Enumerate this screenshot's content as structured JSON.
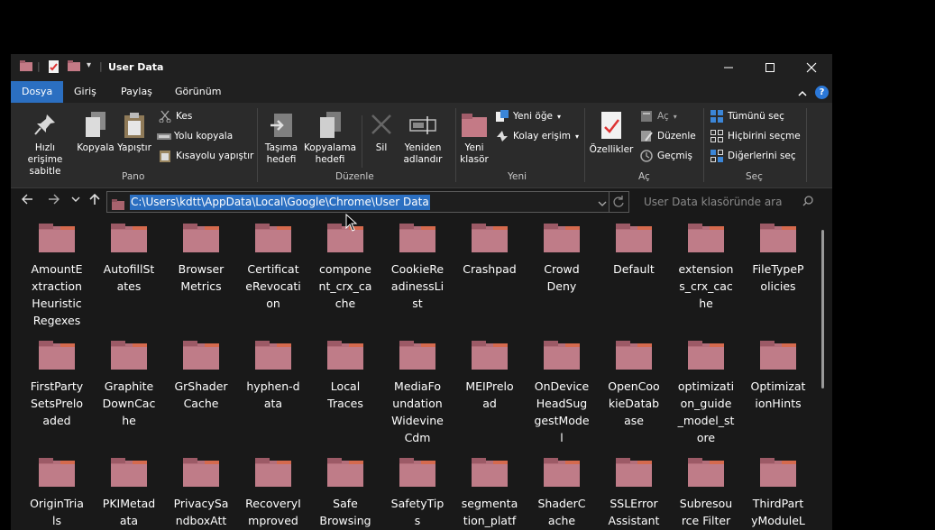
{
  "window": {
    "title": "User Data"
  },
  "tabs": [
    "Dosya",
    "Giriş",
    "Paylaş",
    "Görünüm"
  ],
  "ribbon": {
    "pano": {
      "label": "Pano",
      "pin": "Hızlı erişime sabitle",
      "copy": "Kopyala",
      "paste": "Yapıştır",
      "cut": "Kes",
      "copy_path": "Yolu kopyala",
      "paste_shortcut": "Kısayolu yapıştır"
    },
    "duzenle": {
      "label": "Düzenle",
      "move_to": "Taşıma hedefi",
      "copy_to": "Kopyalama hedefi",
      "delete": "Sil",
      "rename": "Yeniden adlandır"
    },
    "yeni": {
      "label": "Yeni",
      "new_folder": "Yeni klasör",
      "new_item": "Yeni öğe",
      "easy_access": "Kolay erişim"
    },
    "ac": {
      "label": "Aç",
      "properties": "Özellikler",
      "open": "Aç",
      "edit": "Düzenle",
      "history": "Geçmiş"
    },
    "sec": {
      "label": "Seç",
      "select_all": "Tümünü seç",
      "select_none": "Hiçbirini seçme",
      "invert": "Diğerlerini seç"
    }
  },
  "address": {
    "path": "C:\\Users\\kdtt\\AppData\\Local\\Google\\Chrome\\User Data",
    "search_placeholder": "User Data klasöründe ara"
  },
  "folders": [
    [
      "AmountE",
      "xtraction",
      "Heuristic",
      "Regexes"
    ],
    [
      "AutofillSt",
      "ates"
    ],
    [
      "Browser",
      "Metrics"
    ],
    [
      "Certificat",
      "eRevocati",
      "on"
    ],
    [
      "compone",
      "nt_crx_ca",
      "che"
    ],
    [
      "CookieRe",
      "adinessLi",
      "st"
    ],
    [
      "Crashpad"
    ],
    [
      "Crowd",
      "Deny"
    ],
    [
      "Default"
    ],
    [
      "extension",
      "s_crx_cac",
      "he"
    ],
    [
      "FileTypeP",
      "olicies"
    ],
    [
      "FirstParty",
      "SetsPrelo",
      "aded"
    ],
    [
      "Graphite",
      "DownCac",
      "he"
    ],
    [
      "GrShader",
      "Cache"
    ],
    [
      "hyphen-d",
      "ata"
    ],
    [
      "Local",
      "Traces"
    ],
    [
      "MediaFo",
      "undation",
      "Widevine",
      "Cdm"
    ],
    [
      "MEIPrelo",
      "ad"
    ],
    [
      "OnDevice",
      "HeadSug",
      "gestMode",
      "l"
    ],
    [
      "OpenCoo",
      "kieDatab",
      "ase"
    ],
    [
      "optimizati",
      "on_guide",
      "_model_st",
      "ore"
    ],
    [
      "Optimizat",
      "ionHints"
    ],
    [
      "OriginTria",
      "ls"
    ],
    [
      "PKIMetad",
      "ata"
    ],
    [
      "PrivacySa",
      "ndboxAtt"
    ],
    [
      "RecoveryI",
      "mproved"
    ],
    [
      "Safe",
      "Browsing"
    ],
    [
      "SafetyTip",
      "s"
    ],
    [
      "segmenta",
      "tion_platf"
    ],
    [
      "ShaderC",
      "ache"
    ],
    [
      "SSLError",
      "Assistant"
    ],
    [
      "Subresou",
      "rce Filter"
    ],
    [
      "ThirdPart",
      "yModuleL"
    ]
  ]
}
